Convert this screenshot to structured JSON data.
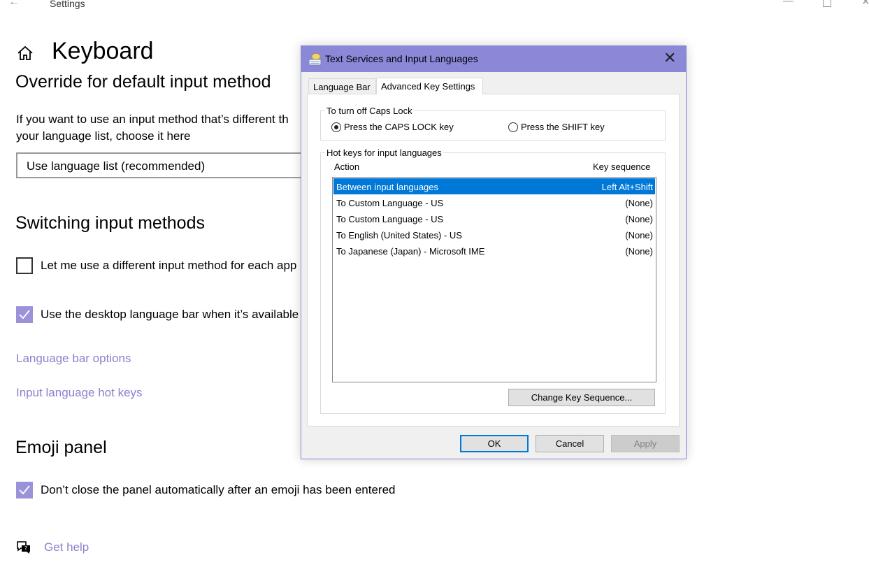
{
  "window": {
    "back_icon": "back-arrow-icon",
    "title": "Settings",
    "minimize_icon": "minimize-icon",
    "maximize_icon": "maximize-icon",
    "close_icon": "close-icon"
  },
  "page": {
    "home_icon": "home-icon",
    "title": "Keyboard"
  },
  "override": {
    "heading": "Override for default input method",
    "description_line1": "If you want to use an input method that’s different th",
    "description_line2": "your language list, choose it here",
    "dropdown_value": "Use language list (recommended)"
  },
  "switching": {
    "heading": "Switching input methods",
    "option1_label": "Let me use a different input method for each app",
    "option1_checked": false,
    "option2_label": "Use the desktop language bar when it’s available",
    "option2_checked": true,
    "link1": "Language bar options",
    "link2": "Input language hot keys"
  },
  "emoji": {
    "heading": "Emoji panel",
    "option_label": "Don’t close the panel automatically after an emoji has been entered",
    "option_checked": true
  },
  "help": {
    "icon": "help-chat-icon",
    "label": "Get help"
  },
  "dialog": {
    "title": "Text Services and Input Languages",
    "icon": "keyboard-icon",
    "close_glyph": "✕",
    "tabs": [
      {
        "label": "Language Bar",
        "active": false
      },
      {
        "label": "Advanced Key Settings",
        "active": true
      }
    ],
    "caps_lock": {
      "group_label": "To turn off Caps Lock",
      "option1": "Press the CAPS LOCK key",
      "option2": "Press the SHIFT key",
      "selected": "option1"
    },
    "hotkeys": {
      "group_label": "Hot keys for input languages",
      "col_action": "Action",
      "col_key": "Key sequence",
      "rows": [
        {
          "action": "Between input languages",
          "key": "Left Alt+Shift",
          "selected": true
        },
        {
          "action": "To Custom Language - US",
          "key": "(None)",
          "selected": false
        },
        {
          "action": "To Custom Language - US",
          "key": "(None)",
          "selected": false
        },
        {
          "action": "To English (United States) - US",
          "key": "(None)",
          "selected": false
        },
        {
          "action": "To Japanese (Japan) - Microsoft IME",
          "key": "(None)",
          "selected": false
        }
      ],
      "change_button": "Change Key Sequence..."
    },
    "buttons": {
      "ok": "OK",
      "cancel": "Cancel",
      "apply": "Apply"
    }
  },
  "colors": {
    "accent": "#8b88d8",
    "link": "#8a82cf",
    "selection": "#0078d7"
  }
}
